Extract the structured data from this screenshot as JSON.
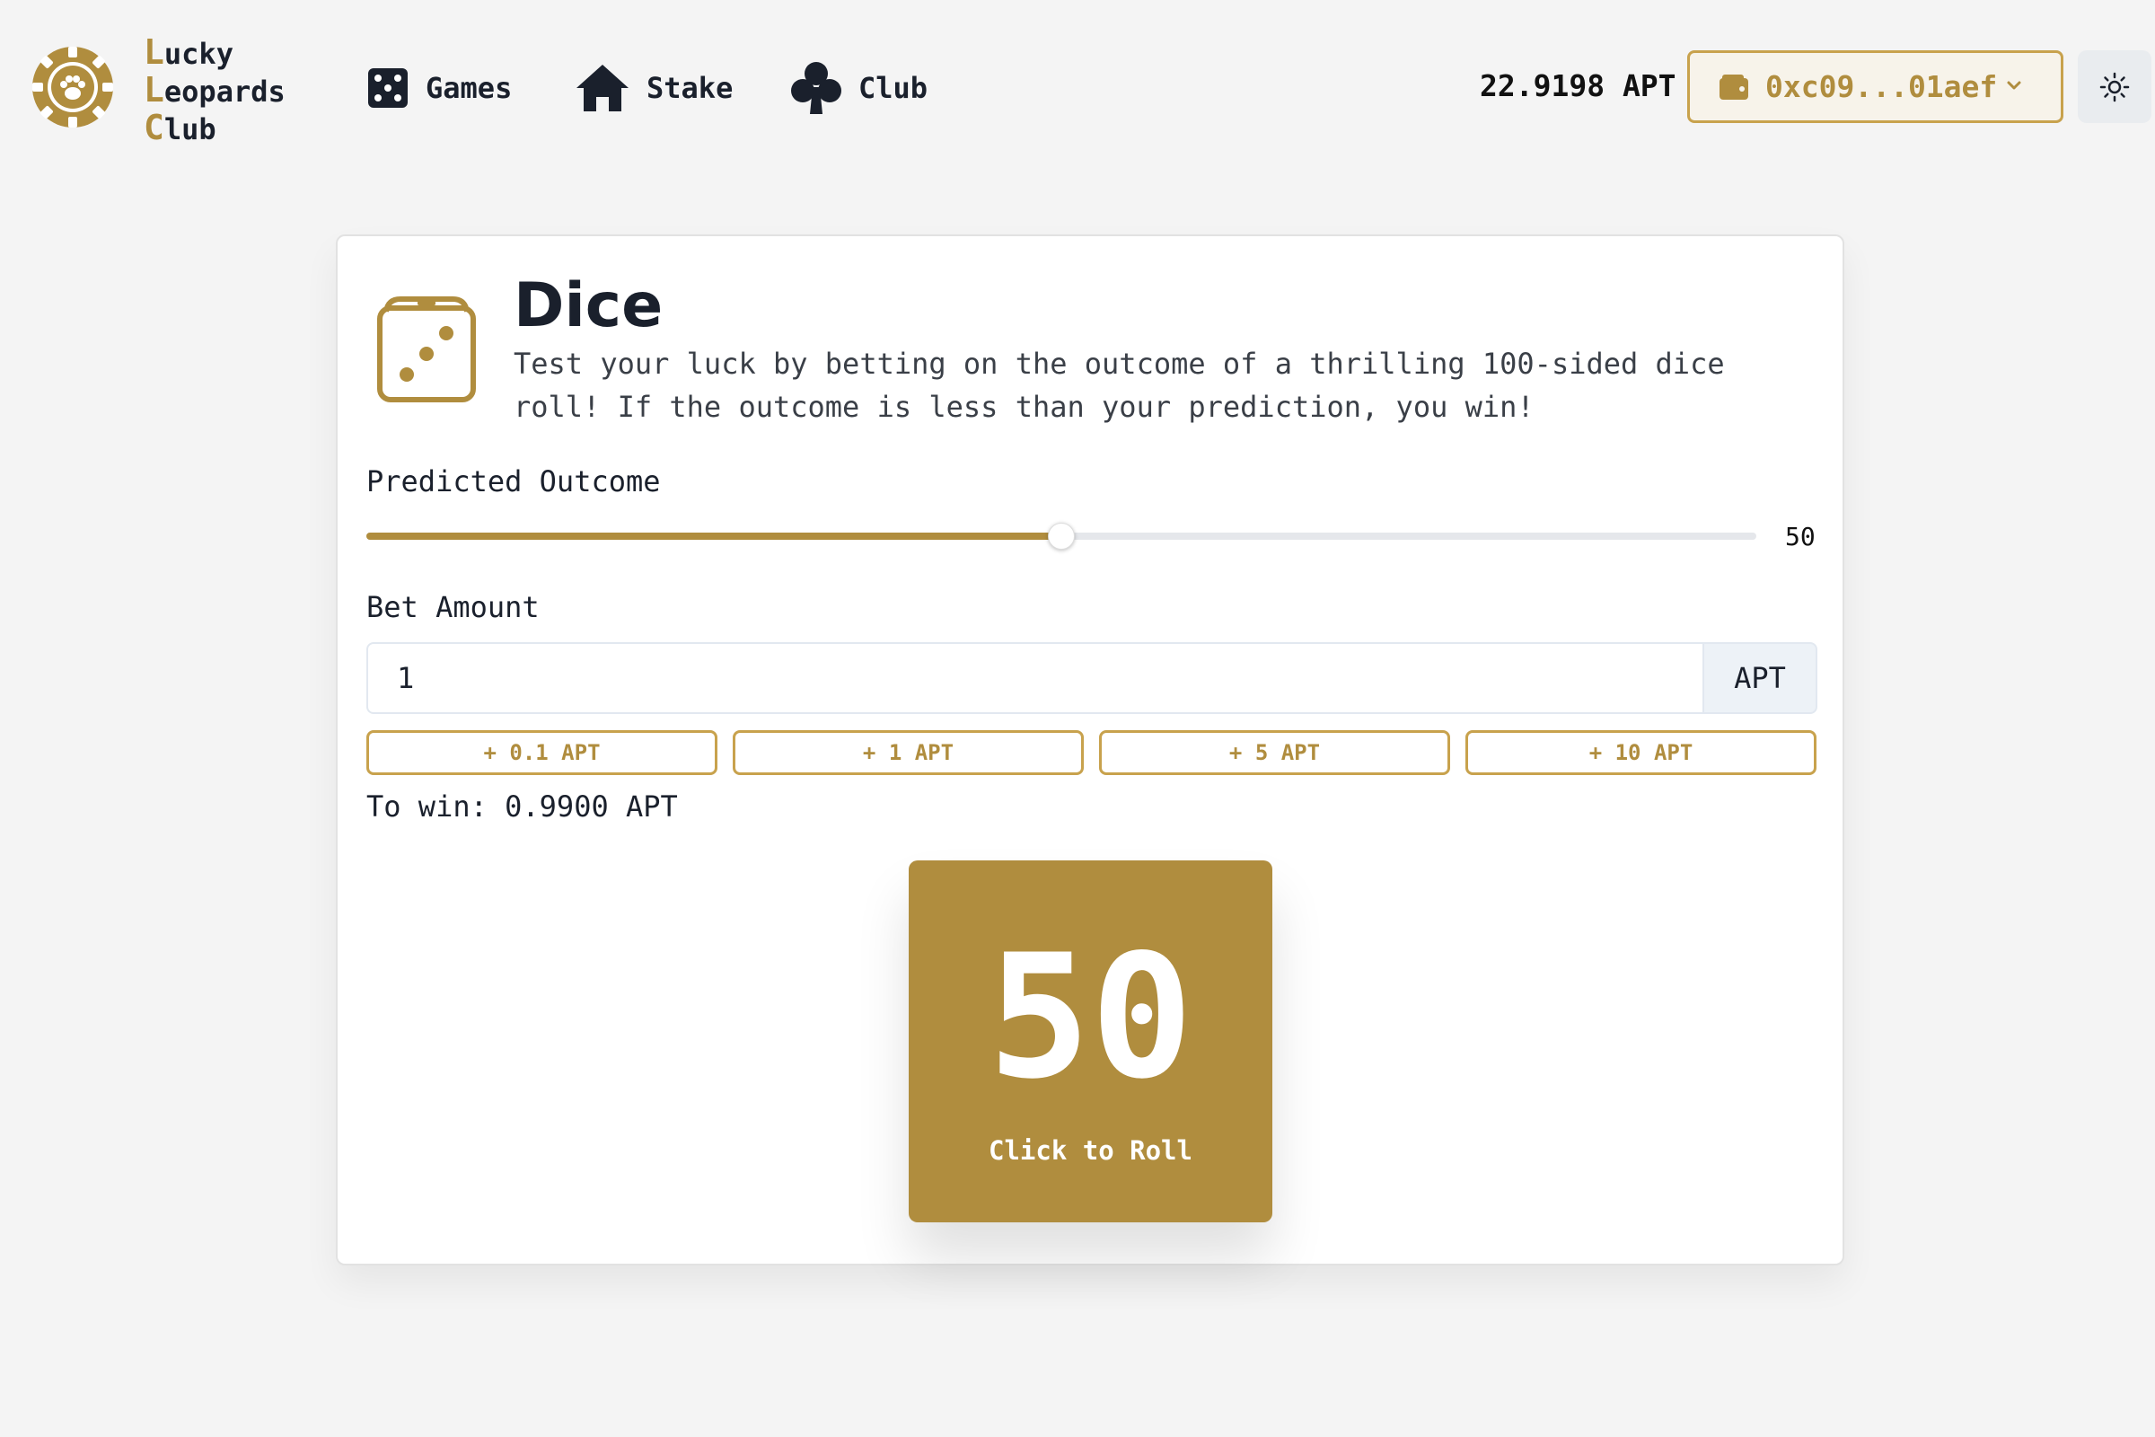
{
  "brand": {
    "line1_cap": "L",
    "line1_rest": "ucky",
    "line2_cap": "L",
    "line2_rest": "eopards",
    "line3_cap": "C",
    "line3_rest": "lub",
    "logo_icon": "paw-chip-icon"
  },
  "nav": {
    "games": "Games",
    "stake": "Stake",
    "club": "Club"
  },
  "header": {
    "balance": "22.9198 APT",
    "wallet_address": "0xc09...01aef",
    "theme_icon": "sun-icon"
  },
  "colors": {
    "accent": "#b08d3e",
    "background": "#f4f4f4",
    "card": "#ffffff",
    "text": "#1a202c"
  },
  "game": {
    "title": "Dice",
    "description": "Test your luck by betting on the outcome of a thrilling 100-sided dice roll! If the outcome is less than your prediction, you win!",
    "predicted_label": "Predicted Outcome",
    "predicted_value": "50",
    "slider_percent": 50,
    "bet_label": "Bet Amount",
    "bet_value": "1",
    "bet_unit": "APT",
    "quick_bets": [
      "+ 0.1 APT",
      "+ 1 APT",
      "+ 5 APT",
      "+ 10 APT"
    ],
    "to_win": "To win: 0.9900 APT",
    "roll_number": "50",
    "roll_label": "Click to Roll"
  }
}
